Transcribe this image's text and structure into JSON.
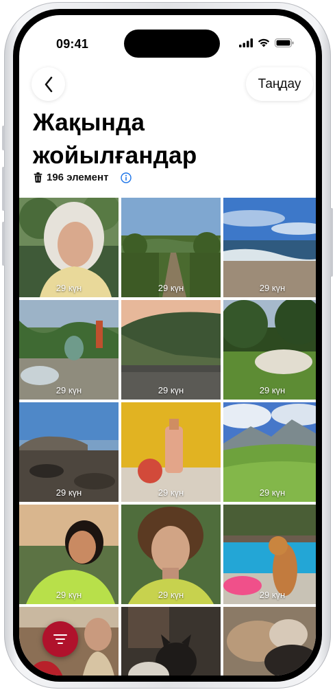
{
  "status_bar": {
    "time": "09:41"
  },
  "nav": {
    "select_label": "Таңдау"
  },
  "page": {
    "title_line1": "Жақында",
    "title_line2": "жойылғандар",
    "count_label": "196 элемент"
  },
  "photos": [
    {
      "label": "29 күн"
    },
    {
      "label": "29 күн"
    },
    {
      "label": "29 күн"
    },
    {
      "label": "29 күн"
    },
    {
      "label": "29 күн"
    },
    {
      "label": "29 күн"
    },
    {
      "label": "29 күн"
    },
    {
      "label": "29 күн"
    },
    {
      "label": "29 күн"
    },
    {
      "label": "29 күн"
    },
    {
      "label": "29 күн"
    },
    {
      "label": "29 күн"
    },
    {
      "label": ""
    },
    {
      "label": ""
    },
    {
      "label": ""
    }
  ],
  "icons": {
    "back": "chevron-left-icon",
    "trash": "trash-icon",
    "info": "info-icon",
    "filter": "filter-icon"
  },
  "colors": {
    "accent": "#1a73e8",
    "filter_button": "#b0122c"
  }
}
